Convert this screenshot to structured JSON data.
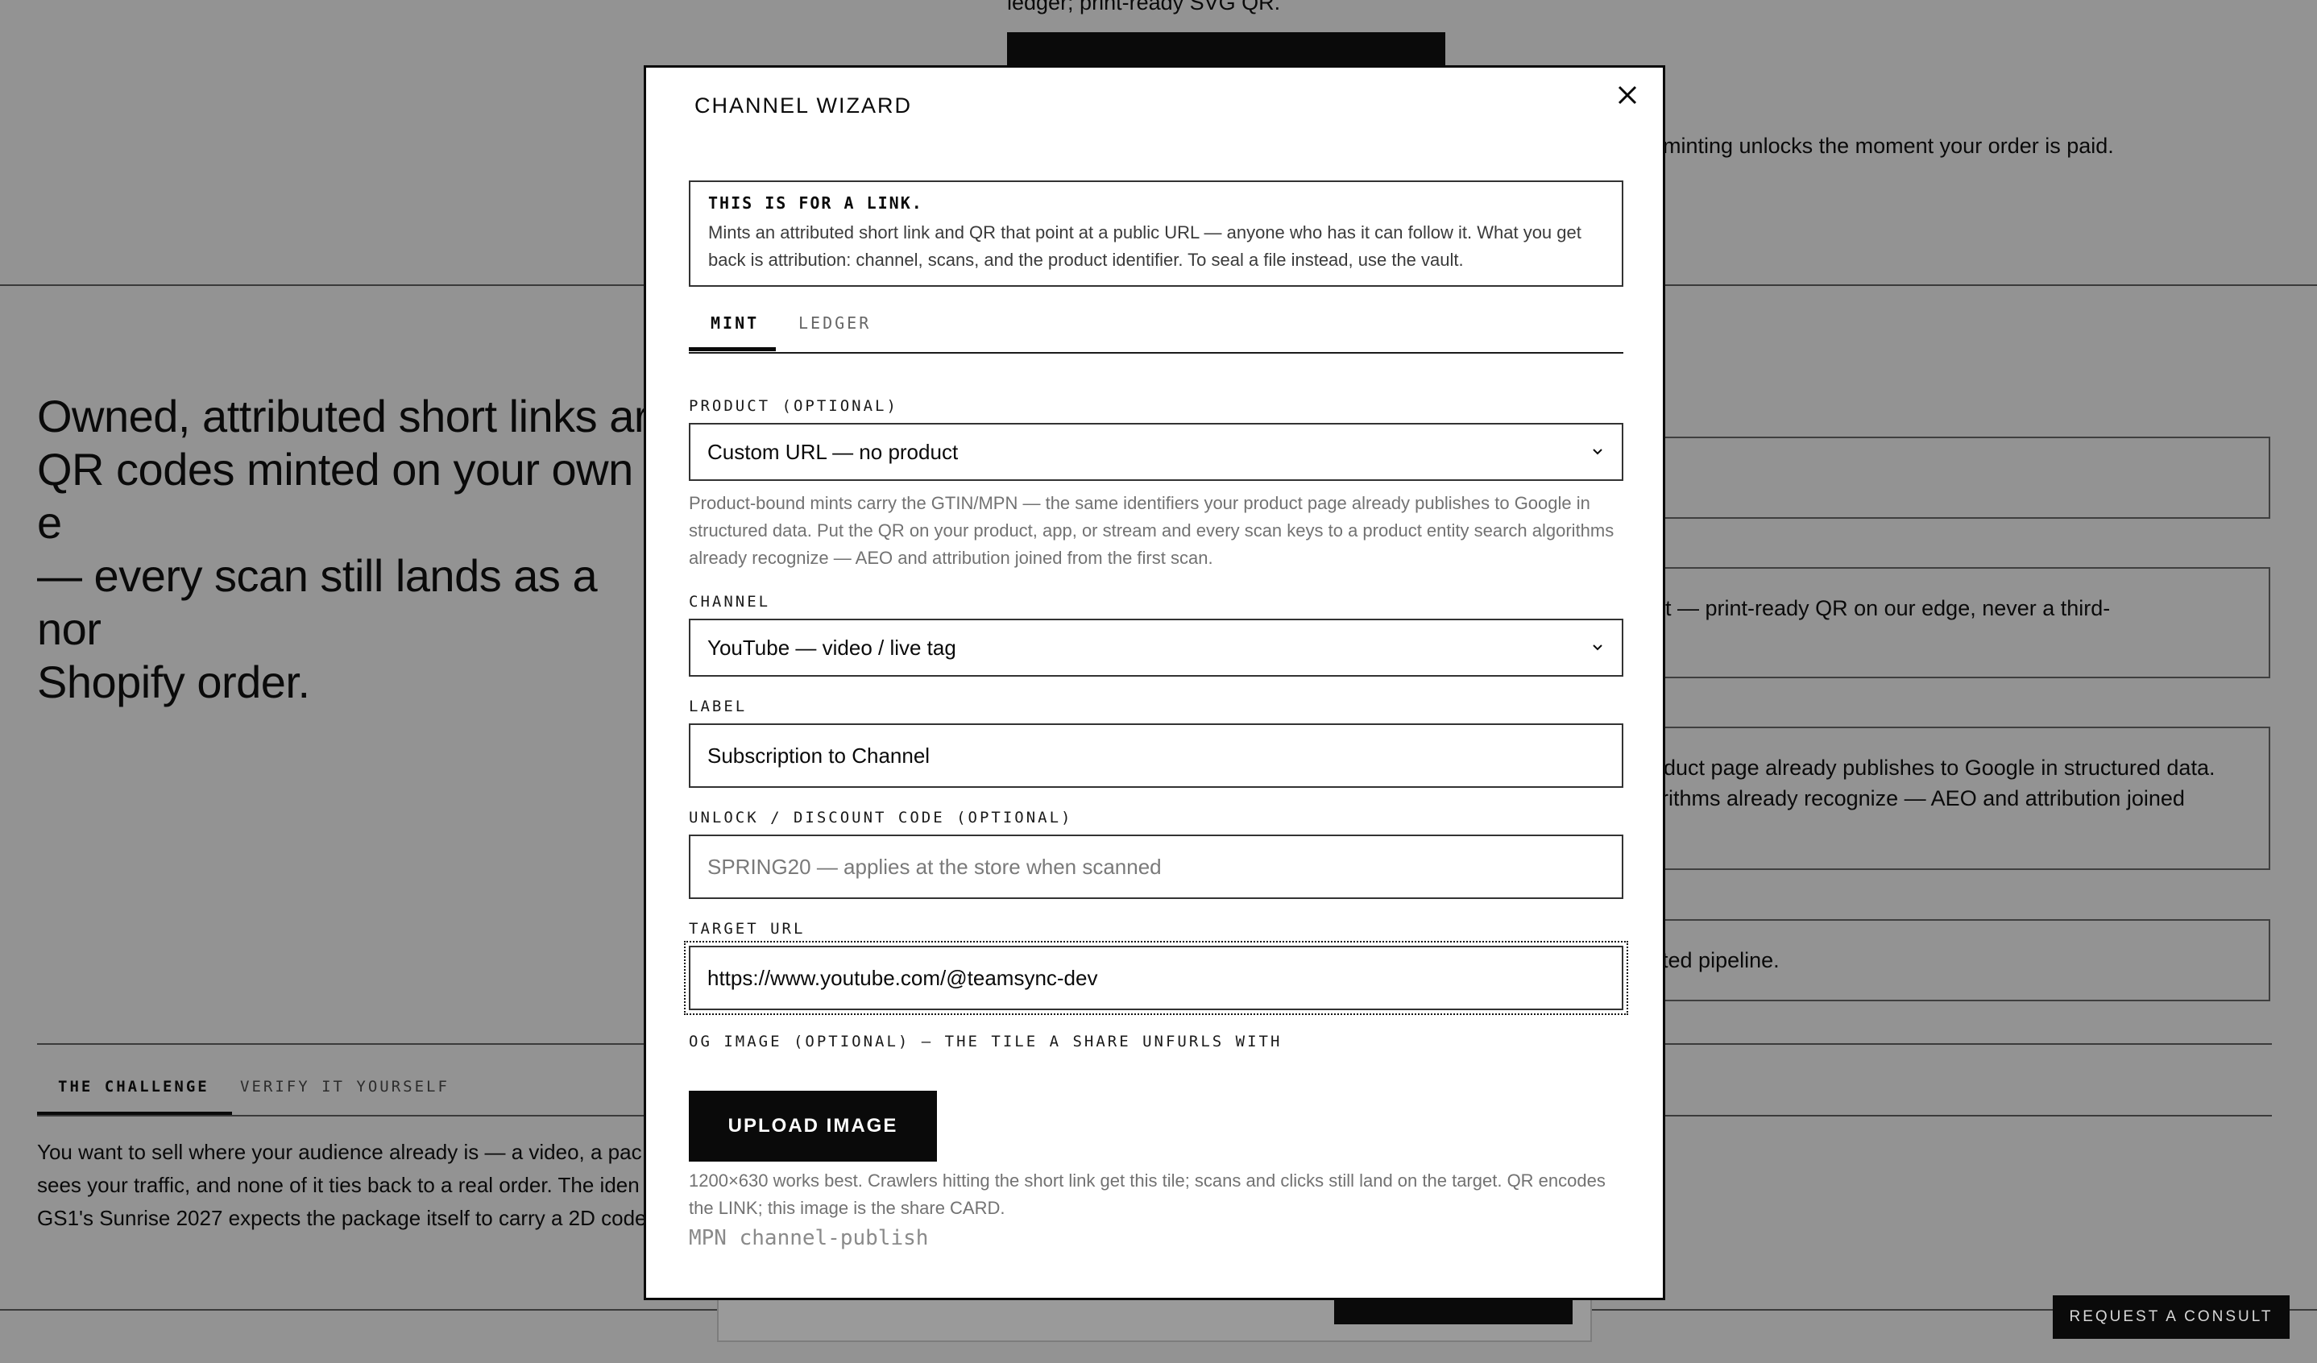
{
  "background": {
    "top_text": "ledger; print-ready SVG QR.",
    "right_text": "minting unlocks the moment your order is paid.",
    "headline": [
      "Owned, attributed short links ar",
      "QR codes minted on your own e",
      "— every scan still lands as a nor",
      "Shopify order."
    ],
    "cards": [
      {
        "lines": [
          ""
        ]
      },
      {
        "lines": [
          "print — print-ready QR on our edge, never a third-"
        ]
      },
      {
        "lines": [
          "product page already publishes to Google in structured data.",
          "lgorithms already recognize — AEO and attribution joined"
        ]
      },
      {
        "lines": [
          "-gated pipeline."
        ]
      }
    ],
    "tabs": [
      "THE CHALLENGE",
      "VERIFY IT YOURSELF"
    ],
    "body_lines": [
      "You want to sell where your audience already is — a video, a pac",
      "sees your traffic, and none of it ties back to a real order. The iden",
      "GS1's Sunrise 2027 expects the package itself to carry a 2D code"
    ],
    "consult_button": "REQUEST A CONSULT"
  },
  "modal": {
    "title": "CHANNEL WIZARD",
    "notice": {
      "title": "THIS IS FOR A LINK.",
      "body": "Mints an attributed short link and QR that point at a public URL — anyone who has it can follow it. What you get back is attribution: channel, scans, and the product identifier. To seal a file instead, use the vault."
    },
    "tabs": {
      "mint": "MINT",
      "ledger": "LEDGER"
    },
    "product": {
      "label": "PRODUCT (OPTIONAL)",
      "value": "Custom URL — no product",
      "help": "Product-bound mints carry the GTIN/MPN — the same identifiers your product page already publishes to Google in structured data. Put the QR on your product, app, or stream and every scan keys to a product entity search algorithms already recognize — AEO and attribution joined from the first scan."
    },
    "channel": {
      "label": "CHANNEL",
      "value": "YouTube — video / live tag"
    },
    "label_field": {
      "label": "LABEL",
      "value": "Subscription to Channel"
    },
    "unlock": {
      "label": "UNLOCK / DISCOUNT CODE (OPTIONAL)",
      "placeholder": "SPRING20 — applies at the store when scanned"
    },
    "target": {
      "label": "TARGET URL",
      "value": "https://www.youtube.com/@teamsync-dev"
    },
    "og": {
      "label": "OG IMAGE (OPTIONAL) — THE TILE A SHARE UNFURLS WITH",
      "button": "UPLOAD IMAGE",
      "help": "1200×630 works best. Crawlers hitting the short link get this tile; scans and clicks still land on the target. QR encodes the LINK; this image is the share CARD."
    },
    "mpn": "MPN channel-publish"
  }
}
